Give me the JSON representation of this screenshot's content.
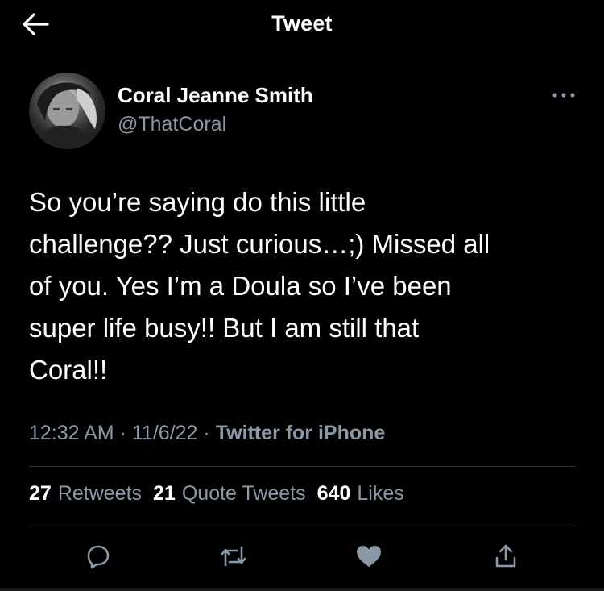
{
  "header": {
    "title": "Tweet",
    "back_icon": "arrow-left-icon"
  },
  "tweet": {
    "author_name": "Coral Jeanne Smith",
    "author_handle": "@ThatCoral",
    "more_icon": "more-horizontal-icon",
    "text": "So you’re saying do this little\nchallenge?? Just curious…;) Missed all\nof you.  Yes I’m a Doula so I’ve been\nsuper life busy!! But I am still that\nCoral!!",
    "time": "12:32 AM",
    "date": "11/6/22",
    "separator": "·",
    "source": "Twitter for iPhone"
  },
  "stats": {
    "retweets_count": "27",
    "retweets_label": "Retweets",
    "quotes_count": "21",
    "quotes_label": "Quote Tweets",
    "likes_count": "640",
    "likes_label": "Likes"
  },
  "actions": {
    "reply_icon": "reply-icon",
    "retweet_icon": "retweet-icon",
    "like_icon": "heart-icon",
    "share_icon": "share-icon"
  },
  "colors": {
    "background": "#000000",
    "primary_text": "#ffffff",
    "secondary_text": "#8b98a5",
    "divider": "#2f3336"
  }
}
